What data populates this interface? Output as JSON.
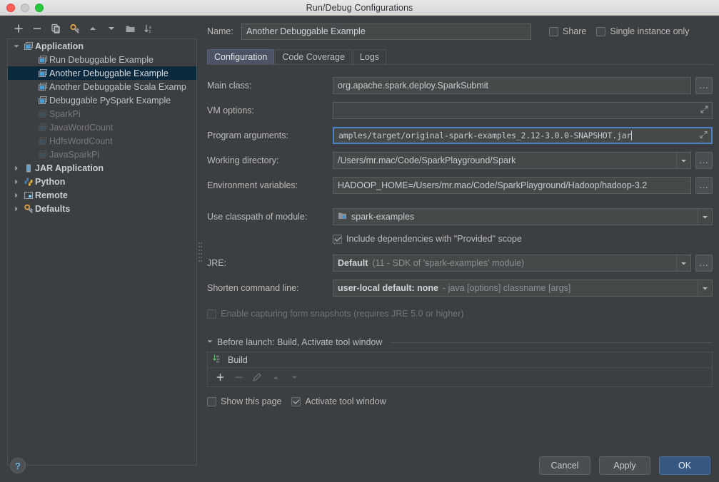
{
  "window": {
    "title": "Run/Debug Configurations",
    "traffic_lights": [
      "close-button",
      "minimize-button",
      "maximize-button"
    ]
  },
  "sidebar": {
    "toolbar": [
      {
        "name": "add-configuration-button",
        "icon": "plus-icon",
        "label": "+"
      },
      {
        "name": "remove-configuration-button",
        "icon": "minus-icon",
        "label": "−"
      },
      {
        "name": "copy-configuration-button",
        "icon": "copy-icon",
        "label": ""
      },
      {
        "name": "edit-templates-button",
        "icon": "gear-wrench-icon",
        "label": ""
      },
      {
        "name": "move-up-button",
        "icon": "triangle-up-icon",
        "label": ""
      },
      {
        "name": "move-down-button",
        "icon": "triangle-down-icon",
        "label": ""
      },
      {
        "name": "new-folder-button",
        "icon": "folder-icon",
        "label": ""
      },
      {
        "name": "sort-alphabetically-button",
        "icon": "sort-az-icon",
        "label": ""
      }
    ],
    "tree": [
      {
        "label": "Application",
        "level": 1,
        "expanded": true,
        "icon": "application-icon",
        "bold": true,
        "dim": false,
        "selected": false
      },
      {
        "label": "Run Debuggable Example",
        "level": 2,
        "expanded": null,
        "icon": "application-icon",
        "bold": false,
        "dim": false,
        "selected": false
      },
      {
        "label": "Another Debuggable Example",
        "level": 2,
        "expanded": null,
        "icon": "application-icon",
        "bold": false,
        "dim": false,
        "selected": true
      },
      {
        "label": "Another Debuggable Scala Examp",
        "level": 2,
        "expanded": null,
        "icon": "application-icon",
        "bold": false,
        "dim": false,
        "selected": false
      },
      {
        "label": "Debuggable PySpark Example",
        "level": 2,
        "expanded": null,
        "icon": "application-icon",
        "bold": false,
        "dim": false,
        "selected": false
      },
      {
        "label": "SparkPi",
        "level": 2,
        "expanded": null,
        "icon": "application-icon",
        "bold": false,
        "dim": true,
        "selected": false
      },
      {
        "label": "JavaWordCount",
        "level": 2,
        "expanded": null,
        "icon": "application-icon",
        "bold": false,
        "dim": true,
        "selected": false
      },
      {
        "label": "HdfsWordCount",
        "level": 2,
        "expanded": null,
        "icon": "application-icon",
        "bold": false,
        "dim": true,
        "selected": false
      },
      {
        "label": "JavaSparkPi",
        "level": 2,
        "expanded": null,
        "icon": "application-icon",
        "bold": false,
        "dim": true,
        "selected": false
      },
      {
        "label": "JAR Application",
        "level": 1,
        "expanded": false,
        "icon": "jar-icon",
        "bold": true,
        "dim": false,
        "selected": false
      },
      {
        "label": "Python",
        "level": 1,
        "expanded": false,
        "icon": "python-icon",
        "bold": true,
        "dim": false,
        "selected": false
      },
      {
        "label": "Remote",
        "level": 1,
        "expanded": false,
        "icon": "remote-icon",
        "bold": true,
        "dim": false,
        "selected": false
      },
      {
        "label": "Defaults",
        "level": 1,
        "expanded": false,
        "icon": "gear-wrench-icon",
        "bold": true,
        "dim": false,
        "selected": false
      }
    ]
  },
  "header": {
    "name_label": "Name:",
    "name_value": "Another Debuggable Example",
    "share_label": "Share",
    "share_checked": false,
    "single_instance_label": "Single instance only",
    "single_instance_checked": false
  },
  "tabs": [
    {
      "label": "Configuration",
      "active": true
    },
    {
      "label": "Code Coverage",
      "active": false
    },
    {
      "label": "Logs",
      "active": false
    }
  ],
  "form": {
    "main_class": {
      "label": "Main class:",
      "value": "org.apache.spark.deploy.SparkSubmit",
      "browse_label": "..."
    },
    "vm_options": {
      "label": "VM options:",
      "value": "",
      "expand_icon": "expand-diagonal-icon"
    },
    "program_arguments": {
      "label": "Program arguments:",
      "value": "amples/target/original-spark-examples_2.12-3.0.0-SNAPSHOT.jar",
      "focused": true,
      "expand_icon": "expand-diagonal-icon"
    },
    "working_directory": {
      "label": "Working directory:",
      "value": "/Users/mr.mac/Code/SparkPlayground/Spark",
      "browse_label": "..."
    },
    "environment_variables": {
      "label": "Environment variables:",
      "value": "HADOOP_HOME=/Users/mr.mac/Code/SparkPlayground/Hadoop/hadoop-3.2",
      "browse_label": "..."
    },
    "classpath_module": {
      "label": "Use classpath of module:",
      "value": "spark-examples",
      "icon": "module-icon"
    },
    "include_provided": {
      "label": "Include dependencies with \"Provided\" scope",
      "checked": true
    },
    "jre": {
      "label": "JRE:",
      "value_bold": "Default",
      "value_dim": "(11 - SDK of 'spark-examples' module)",
      "browse_label": "..."
    },
    "shorten_command_line": {
      "label": "Shorten command line:",
      "value_bold": "user-local default: none",
      "value_dim": "- java [options] classname [args]"
    },
    "form_snapshots": {
      "label": "Enable capturing form snapshots (requires JRE 5.0 or higher)",
      "checked": false,
      "disabled": true
    }
  },
  "before_launch": {
    "header": "Before launch: Build, Activate tool window",
    "items": [
      {
        "label": "Build",
        "icon": "build-icon"
      }
    ],
    "actions": [
      {
        "name": "add-task-button",
        "icon": "plus-icon",
        "label": "+",
        "disabled": false
      },
      {
        "name": "remove-task-button",
        "icon": "minus-icon",
        "label": "−",
        "disabled": true
      },
      {
        "name": "edit-task-button",
        "icon": "pencil-icon",
        "label": "",
        "disabled": true
      },
      {
        "name": "move-task-up-button",
        "icon": "triangle-up-icon",
        "label": "",
        "disabled": true
      },
      {
        "name": "move-task-down-button",
        "icon": "triangle-down-icon",
        "label": "",
        "disabled": true
      }
    ],
    "show_this_page": {
      "label": "Show this page",
      "checked": false
    },
    "activate_tool_window": {
      "label": "Activate tool window",
      "checked": true
    }
  },
  "footer": {
    "help_label": "?",
    "cancel_label": "Cancel",
    "apply_label": "Apply",
    "ok_label": "OK"
  },
  "colors": {
    "background": "#3c3f41",
    "field_background": "#45494a",
    "selection": "#0d293e",
    "accent": "#4a82c4",
    "primary_button": "#365880",
    "tab_active": "#4b5364"
  }
}
